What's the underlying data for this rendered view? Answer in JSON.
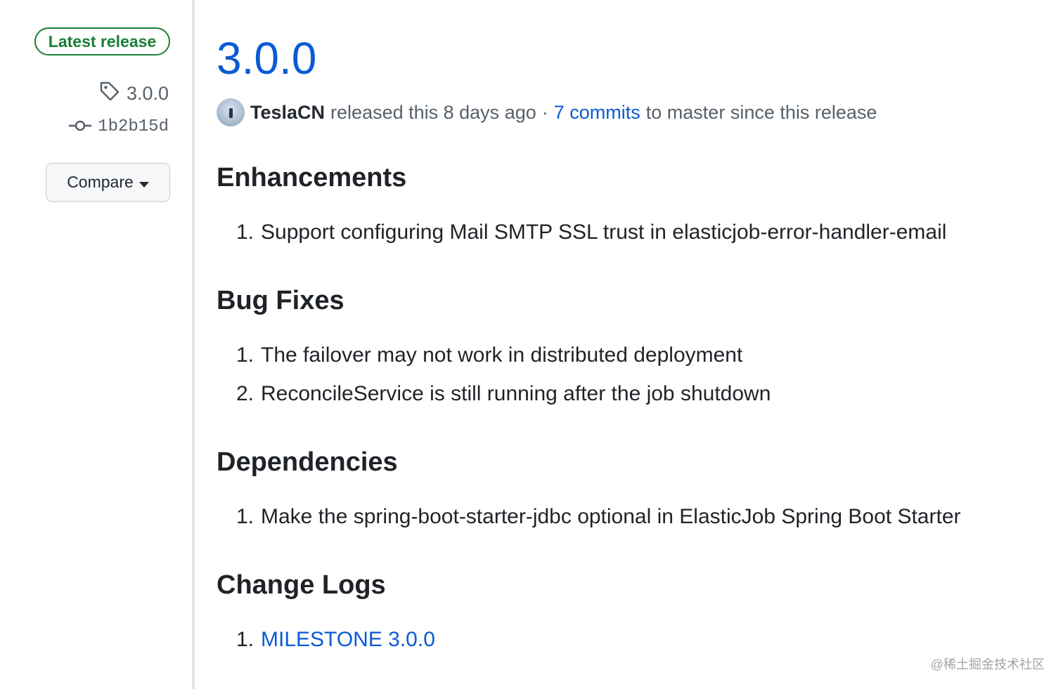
{
  "sidebar": {
    "latest_badge": "Latest release",
    "tag": "3.0.0",
    "commit": "1b2b15d",
    "compare_label": "Compare"
  },
  "release": {
    "title": "3.0.0",
    "author": "TeslaCN",
    "released_text": "released this 8 days ago",
    "separator": "·",
    "commits_link": "7 commits",
    "commits_suffix": "to master since this release"
  },
  "sections": [
    {
      "heading": "Enhancements",
      "items": [
        {
          "num": "1.",
          "text": "Support configuring Mail SMTP SSL trust in elasticjob-error-handler-email"
        }
      ]
    },
    {
      "heading": "Bug Fixes",
      "items": [
        {
          "num": "1.",
          "text": "The failover may not work in distributed deployment"
        },
        {
          "num": "2.",
          "text": "ReconcileService is still running after the job shutdown"
        }
      ]
    },
    {
      "heading": "Dependencies",
      "items": [
        {
          "num": "1.",
          "text": "Make the spring-boot-starter-jdbc optional in ElasticJob Spring Boot Starter"
        }
      ]
    },
    {
      "heading": "Change Logs",
      "items": [
        {
          "num": "1.",
          "text": "MILESTONE 3.0.0"
        }
      ]
    }
  ],
  "watermark": "@稀土掘金技术社区",
  "colors": {
    "link": "#0a5ad4",
    "badge_green": "#1a7f37",
    "muted": "#57606a"
  }
}
